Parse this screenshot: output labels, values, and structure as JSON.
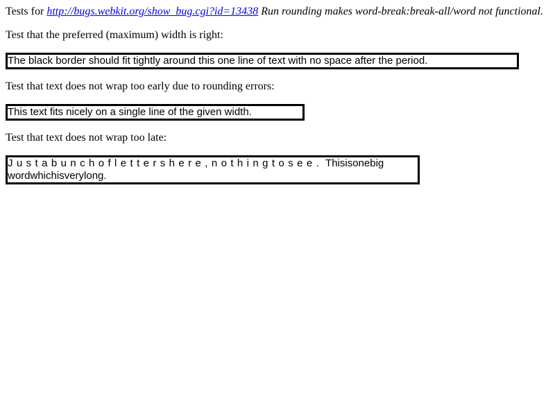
{
  "intro": {
    "prefix": "Tests for ",
    "bug_link": "http://bugs.webkit.org/show_bug.cgi?id=13438",
    "bug_title": " Run rounding makes word-break:break-all/word not functional."
  },
  "tests": [
    {
      "caption": "Test that the preferred (maximum) width is right:",
      "box_text": "The black border should fit tightly around this one line of text with no space after the period."
    },
    {
      "caption": "Test that text does not wrap too early due to rounding errors:",
      "box_text": "This text fits nicely on a single line of the given width."
    },
    {
      "caption": "Test that text does not wrap too late:",
      "box_text_spaced": "Justabunchoflettershere,nothingtosee.",
      "box_text_line1_rest": " Thisisonebig",
      "box_text_line2": "wordwhichisverylong."
    }
  ]
}
